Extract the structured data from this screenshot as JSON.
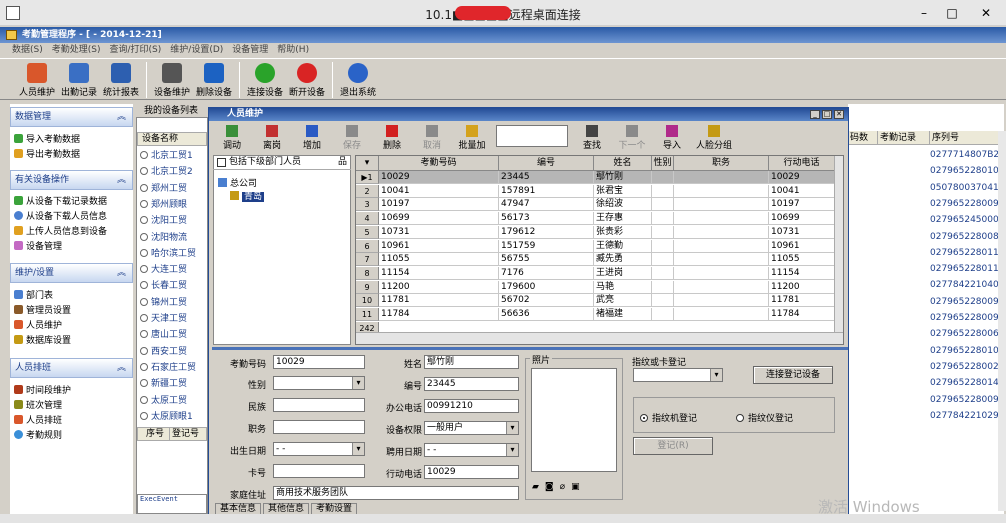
{
  "remote": {
    "title": "10.1■■■■■远程桌面连接",
    "min": "–",
    "max": "□",
    "close": "✕"
  },
  "app": {
    "title": "考勤管理程序 - [ - 2014-12-21]"
  },
  "menu": [
    "数据(S)",
    "考勤处理(S)",
    "查询/打印(S)",
    "维护/设置(D)",
    "设备管理",
    "帮助(H)"
  ],
  "toolbar": [
    {
      "label": "人员维护",
      "color": "#d9572b"
    },
    {
      "label": "出勤记录",
      "color": "#3a6fc4"
    },
    {
      "label": "统计报表",
      "color": "#2d5fb0"
    },
    {
      "label": "设备维护",
      "color": "#555555"
    },
    {
      "label": "删除设备",
      "color": "#1c62c2"
    },
    {
      "label": "连接设备",
      "color": "#2aa32a"
    },
    {
      "label": "断开设备",
      "color": "#d92424"
    },
    {
      "label": "退出系统",
      "color": "#2a63c8"
    }
  ],
  "left": {
    "sections": [
      {
        "title": "数据管理",
        "items": [
          "导入考勤数据",
          "导出考勤数据"
        ]
      },
      {
        "title": "有关设备操作",
        "items": [
          "从设备下载记录数据",
          "从设备下载人员信息",
          "上传人员信息到设备",
          "设备管理"
        ]
      },
      {
        "title": "维护/设置",
        "items": [
          "部门表",
          "管理员设置",
          "人员维护",
          "数据库设置"
        ]
      },
      {
        "title": "人员排班",
        "items": [
          "时间段维护",
          "班次管理",
          "人员排班",
          "考勤规则"
        ]
      }
    ]
  },
  "devices": {
    "tab": "我的设备列表",
    "header": "设备名称",
    "items": [
      "北京工贸1",
      "北京工贸2",
      "郑州工贸",
      "郑州顾眼",
      "沈阳工贸",
      "沈阳物流",
      "哈尔滨工贸",
      "大连工贸",
      "长春工贸",
      "锦州工贸",
      "天津工贸",
      "唐山工贸",
      "西安工贸",
      "石家庄工贸",
      "新疆工贸",
      "太原工贸",
      "太原顾眼1"
    ],
    "lower_cols": [
      "序号",
      "登记号"
    ],
    "exec": "ExecEvent"
  },
  "right": {
    "cols": [
      "码数",
      "考勤记录",
      "序列号"
    ],
    "serials": [
      "0277714807B2",
      "0279652280104",
      "0507800370416",
      "0279652280096",
      "0279652450009",
      "0279652280085",
      "0279652280119",
      "0279652280117",
      "0277842210405",
      "0279652280092",
      "0279652280099",
      "0279652280069",
      "0279652280109",
      "0279652280022",
      "0279652280143",
      "0279652280095",
      "0277842210298"
    ]
  },
  "dialog": {
    "title": "人员维护",
    "toolbar": [
      {
        "label": "调动",
        "enabled": true,
        "color": "#3a8f3a"
      },
      {
        "label": "离岗",
        "enabled": true,
        "color": "#c23030"
      },
      {
        "label": "增加",
        "enabled": true,
        "color": "#2a5ac4"
      },
      {
        "label": "保存",
        "enabled": false,
        "color": "#8a8a8a"
      },
      {
        "label": "删除",
        "enabled": true,
        "color": "#d22020"
      },
      {
        "label": "取消",
        "enabled": false,
        "color": "#8a8a8a"
      },
      {
        "label": "批量加",
        "enabled": true,
        "color": "#d4a21c"
      },
      {
        "label": "查找",
        "enabled": true,
        "color": "#444444"
      },
      {
        "label": "下一个",
        "enabled": false,
        "color": "#8a8a8a"
      },
      {
        "label": "导入",
        "enabled": true,
        "color": "#b02a8a"
      },
      {
        "label": "人脸分组",
        "enabled": true,
        "color": "#c49a14"
      }
    ],
    "include_sub": "包括下级部门人员",
    "tree": {
      "root": "总公司",
      "child": "青岛"
    },
    "grid": {
      "cols": [
        "考勤号码",
        "编号",
        "姓名",
        "性别",
        "职务",
        "行动电话"
      ],
      "rows": [
        [
          "10029",
          "23445",
          "鄢竹刚",
          "",
          "",
          "10029"
        ],
        [
          "10041",
          "157891",
          "张君宝",
          "",
          "",
          "10041"
        ],
        [
          "10197",
          "47947",
          "徐绍波",
          "",
          "",
          "10197"
        ],
        [
          "10699",
          "56173",
          "王存惠",
          "",
          "",
          "10699"
        ],
        [
          "10731",
          "179612",
          "张贵彩",
          "",
          "",
          "10731"
        ],
        [
          "10961",
          "151759",
          "王德勤",
          "",
          "",
          "10961"
        ],
        [
          "11055",
          "56755",
          "臧先勇",
          "",
          "",
          "11055"
        ],
        [
          "11154",
          "7176",
          "王进岗",
          "",
          "",
          "11154"
        ],
        [
          "11200",
          "179600",
          "马艳",
          "",
          "",
          "11200"
        ],
        [
          "11781",
          "56702",
          "武亮",
          "",
          "",
          "11781"
        ],
        [
          "11784",
          "56636",
          "褚福建",
          "",
          "",
          "11784"
        ]
      ],
      "count": "242"
    },
    "form": {
      "l_kqhm": "考勤号码",
      "v_kqhm": "10029",
      "l_xb": "性别",
      "l_mz": "民族",
      "l_zw": "职务",
      "l_csrq": "出生日期",
      "v_csrq": "  -   -  ",
      "l_kh": "卡号",
      "l_jtzz": "家庭住址",
      "v_jtzz": "商用技术服务团队",
      "l_xm": "姓名",
      "v_xm": "鄢竹刚",
      "l_bh": "编号",
      "v_bh": "23445",
      "l_bgdh": "办公电话",
      "v_bgdh": "00991210",
      "l_sbqx": "设备权限",
      "v_sbqx": "一般用户",
      "l_pyrq": "聘用日期",
      "v_pyrq": "  -   -  ",
      "l_xddh": "行动电话",
      "v_xddh": "10029",
      "l_photo": "照片",
      "l_fp": "指纹或卡登记",
      "btn_connect": "连接登记设备",
      "radio1": "指纹机登记",
      "radio2": "指纹仪登记",
      "btn_reg": "登记(R)"
    },
    "tabs": [
      "基本信息",
      "其他信息",
      "考勤设置"
    ]
  },
  "watermark": "激活 Windows"
}
